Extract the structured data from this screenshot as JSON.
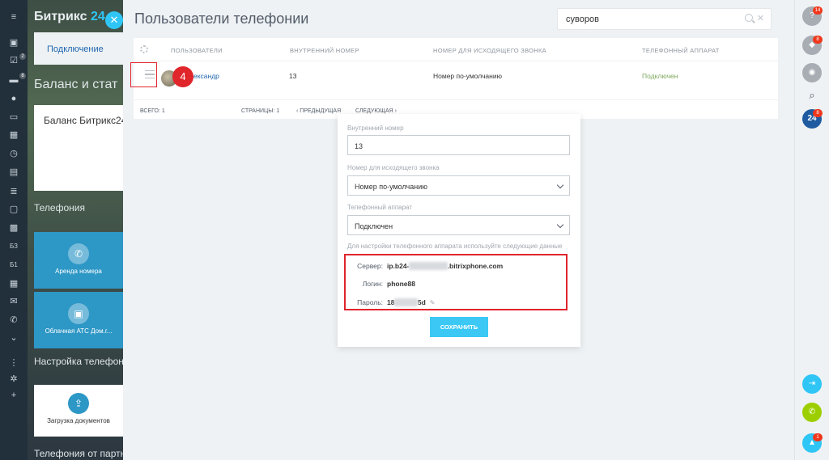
{
  "app": {
    "logo_text": "Битрикс",
    "logo_num": "24",
    "sidebar_badges": [
      "2",
      "8"
    ],
    "bg_tab": "Подключение",
    "bg_heading1": "Баланс и стат",
    "bg_card_title": "Баланс Битрикс24",
    "bg_heading2": "Телефония",
    "bg_tile1": "Аренда номера",
    "bg_tile2": "Облачная АТС Дом.г...",
    "bg_heading3": "Настройка телефон",
    "bg_tile3": "Загрузка документов",
    "bg_heading4": "Телефония от партн",
    "sidebar_icons": [
      "menu-icon",
      "task-icon",
      "chat-icon",
      "crm-icon",
      "calendar-icon",
      "clock-icon",
      "filter-icon",
      "folder-icon",
      "mail-icon",
      "phone-icon",
      "more-icon"
    ],
    "sidebar_text_icons": [
      "БЗ",
      "Б1"
    ]
  },
  "slider": {
    "title": "Пользователи телефонии",
    "search_value": "суворов",
    "columns": [
      "Пользователи",
      "Внутренний номер",
      "Номер для исходящего звонка",
      "Телефонный аппарат"
    ],
    "row": {
      "user": "ександр",
      "internal_number": "13",
      "outgoing": "Номер по-умолчанию",
      "phone_device": "Подключен"
    },
    "step_number": "4",
    "footer": {
      "total": "Всего: 1",
      "pages": "Страницы:  1",
      "prev": "Предыдущая",
      "next": "Следующая"
    }
  },
  "popup": {
    "internal_label": "Внутренний номер",
    "internal_value": "13",
    "outgoing_label": "Номер для исходящего звонка",
    "outgoing_value": "Номер по-умолчанию",
    "device_label": "Телефонный аппарат",
    "device_value": "Подключен",
    "hint": "Для настройки телефонного аппарата используйте следующие данные",
    "server_label": "Сервер:",
    "server_prefix": "ip.b24-",
    "server_blur": "0000000000",
    "server_suffix": ".bitrixphone.com",
    "login_label": "Логин:",
    "login_value": "phone88",
    "password_label": "Пароль:",
    "password_prefix": "18",
    "password_blur": "000000",
    "password_suffix": "5d",
    "save_label": "Сохранить"
  },
  "right_panel": {
    "badges": [
      "14",
      "8",
      "8",
      "1"
    ],
    "logo": "24"
  },
  "colors": {
    "accent": "#2fc6f6",
    "link": "#2067b0",
    "highlight": "#e0252b",
    "status_ok": "#7ca85a"
  }
}
